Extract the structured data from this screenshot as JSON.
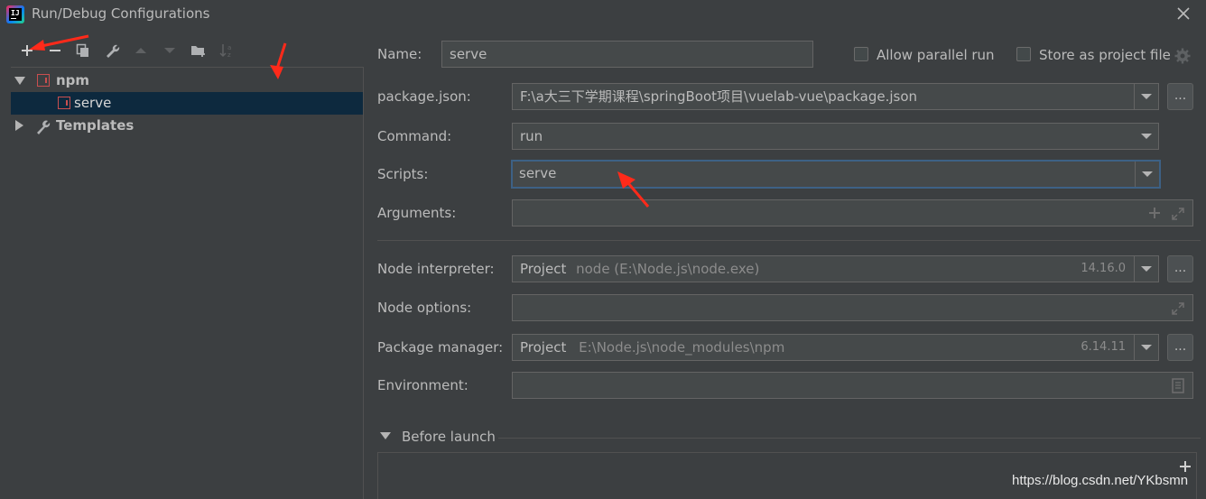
{
  "window": {
    "title": "Run/Debug Configurations",
    "logo_text": "IJ"
  },
  "tree": {
    "items": [
      {
        "label": "npm"
      },
      {
        "label": "serve"
      },
      {
        "label": "Templates"
      }
    ]
  },
  "form": {
    "name": {
      "label": "Name:",
      "value": "serve"
    },
    "allow_parallel": {
      "label": "Allow parallel run",
      "checked": false
    },
    "store_project": {
      "label": "Store as project file",
      "checked": false
    },
    "package_json": {
      "label": "package.json:",
      "value": "F:\\a大三下学期课程\\springBoot项目\\vuelab-vue\\package.json"
    },
    "command": {
      "label": "Command:",
      "value": "run"
    },
    "scripts": {
      "label": "Scripts:",
      "value": "serve"
    },
    "arguments": {
      "label": "Arguments:",
      "value": ""
    },
    "node_interpreter": {
      "label": "Node interpreter:",
      "prefix": "Project",
      "value": "node (E:\\Node.js\\node.exe)",
      "version": "14.16.0"
    },
    "node_options": {
      "label": "Node options:",
      "value": ""
    },
    "package_manager": {
      "label": "Package manager:",
      "prefix": "Project",
      "value": "E:\\Node.js\\node_modules\\npm",
      "version": "6.14.11"
    },
    "environment": {
      "label": "Environment:",
      "value": ""
    },
    "before_launch": {
      "label": "Before launch"
    },
    "browse_label": "..."
  },
  "watermark": "https://blog.csdn.net/YKbsmn",
  "colors": {
    "background": "#3c3f41",
    "field_bg": "#45494a",
    "selection": "#0d293e",
    "focus_border": "#3d6185",
    "npm_red": "#c94f4f",
    "annotation_arrow": "#ff2a1a"
  }
}
